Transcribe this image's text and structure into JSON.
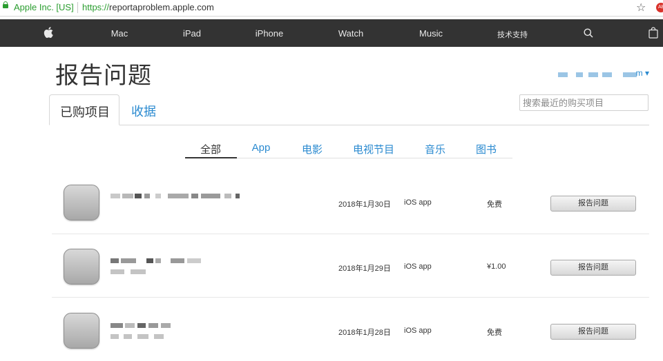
{
  "browser": {
    "site_identity": "Apple Inc. [US]",
    "url_protocol": "https://",
    "url_host": "reportaproblem.apple.com"
  },
  "globalnav": {
    "items": [
      "Mac",
      "iPad",
      "iPhone",
      "Watch",
      "Music",
      "技术支持"
    ]
  },
  "page": {
    "title": "报告问题",
    "account_suffix": "m"
  },
  "tabs": {
    "purchased": "已购项目",
    "receipts": "收据"
  },
  "search": {
    "placeholder": "搜索最近的购买项目"
  },
  "filters": [
    "全部",
    "App",
    "电影",
    "电视节目",
    "音乐",
    "图书"
  ],
  "active_filter": "全部",
  "purchases": [
    {
      "date": "2018年1月30日",
      "type": "iOS app",
      "price": "免费",
      "action": "报告问题"
    },
    {
      "date": "2018年1月29日",
      "type": "iOS app",
      "price": "¥1.00",
      "action": "报告问题"
    },
    {
      "date": "2018年1月28日",
      "type": "iOS app",
      "price": "免费",
      "action": "报告问题"
    }
  ],
  "colors": {
    "nav_bg": "#333333",
    "link": "#2a8ad0",
    "secure_green": "#2a9d2f"
  }
}
